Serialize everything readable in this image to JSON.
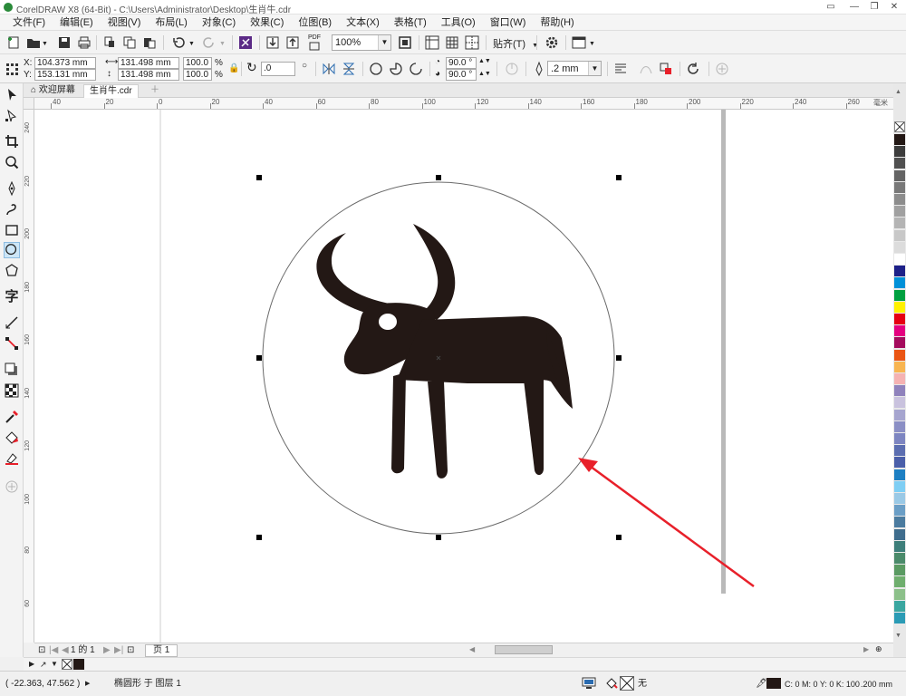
{
  "window": {
    "title": "CorelDRAW X8 (64-Bit) - C:\\Users\\Administrator\\Desktop\\生肖牛.cdr"
  },
  "menu": {
    "items": [
      "文件(F)",
      "编辑(E)",
      "视图(V)",
      "布局(L)",
      "对象(C)",
      "效果(C)",
      "位图(B)",
      "文本(X)",
      "表格(T)",
      "工具(O)",
      "窗口(W)",
      "帮助(H)"
    ]
  },
  "toolbar": {
    "zoom": "100%",
    "snap_label": "贴齐(T)",
    "pdf_label": "PDF"
  },
  "propbar": {
    "x_label": "X:",
    "x_value": "104.373 mm",
    "y_label": "Y:",
    "y_value": "153.131 mm",
    "w_value": "131.498 mm",
    "h_value": "131.498 mm",
    "scale_w": "100.0",
    "scale_h": "100.0",
    "percent": "%",
    "rotation": ".0",
    "angle_start": "90.0 °",
    "angle_end": "90.0 °",
    "outline_width": ".2 mm"
  },
  "tabs": {
    "welcome": "欢迎屏幕",
    "document": "生肖牛.cdr"
  },
  "ruler": {
    "h_labels": [
      "40",
      "20",
      "0",
      "20",
      "40",
      "60",
      "80",
      "100",
      "120",
      "140",
      "160",
      "180",
      "200",
      "220",
      "240",
      "260"
    ],
    "h_unit": "毫米",
    "v_labels": [
      "240",
      "220",
      "200",
      "180",
      "160",
      "140",
      "120",
      "100",
      "80",
      "60"
    ]
  },
  "pagenav": {
    "page_count": "1 的 1",
    "page_tab": "页 1"
  },
  "status": {
    "coords": "( -22.363, 47.562 )",
    "object_info": "椭圆形 于 图层 1",
    "fill_none": "无",
    "outline_info": "C: 0 M: 0 Y: 0 K: 100",
    "outline_width": ".200 mm"
  },
  "colors": {
    "accent_red": "#e8202a",
    "ox_fill": "#231815",
    "selection_handle": "#000000"
  },
  "palette": {
    "swatches": [
      "#231815",
      "#3c3c3c",
      "#505050",
      "#646464",
      "#787878",
      "#8c8c8c",
      "#a0a0a0",
      "#b4b4b4",
      "#c8c8c8",
      "#dcdcdc",
      "#ffffff",
      "#1d2088",
      "#0090d8",
      "#00a040",
      "#fff100",
      "#e60012",
      "#e4007f",
      "#a40b5d",
      "#ea5514",
      "#f8b551",
      "#f5b2b2",
      "#8f82bc",
      "#c9c2de",
      "#a6a5cf",
      "#8b8fc5",
      "#7d85c1",
      "#5b6db0",
      "#4a5ea9",
      "#1d7fc2",
      "#7ecef4",
      "#9ac9e6",
      "#6a9ec6",
      "#4b7b9f",
      "#3f6d8d",
      "#3d7e7a",
      "#4a8a6a",
      "#5a9a62",
      "#6fae6e",
      "#8cc08a",
      "#3aa6a0",
      "#2b9bb5"
    ]
  }
}
